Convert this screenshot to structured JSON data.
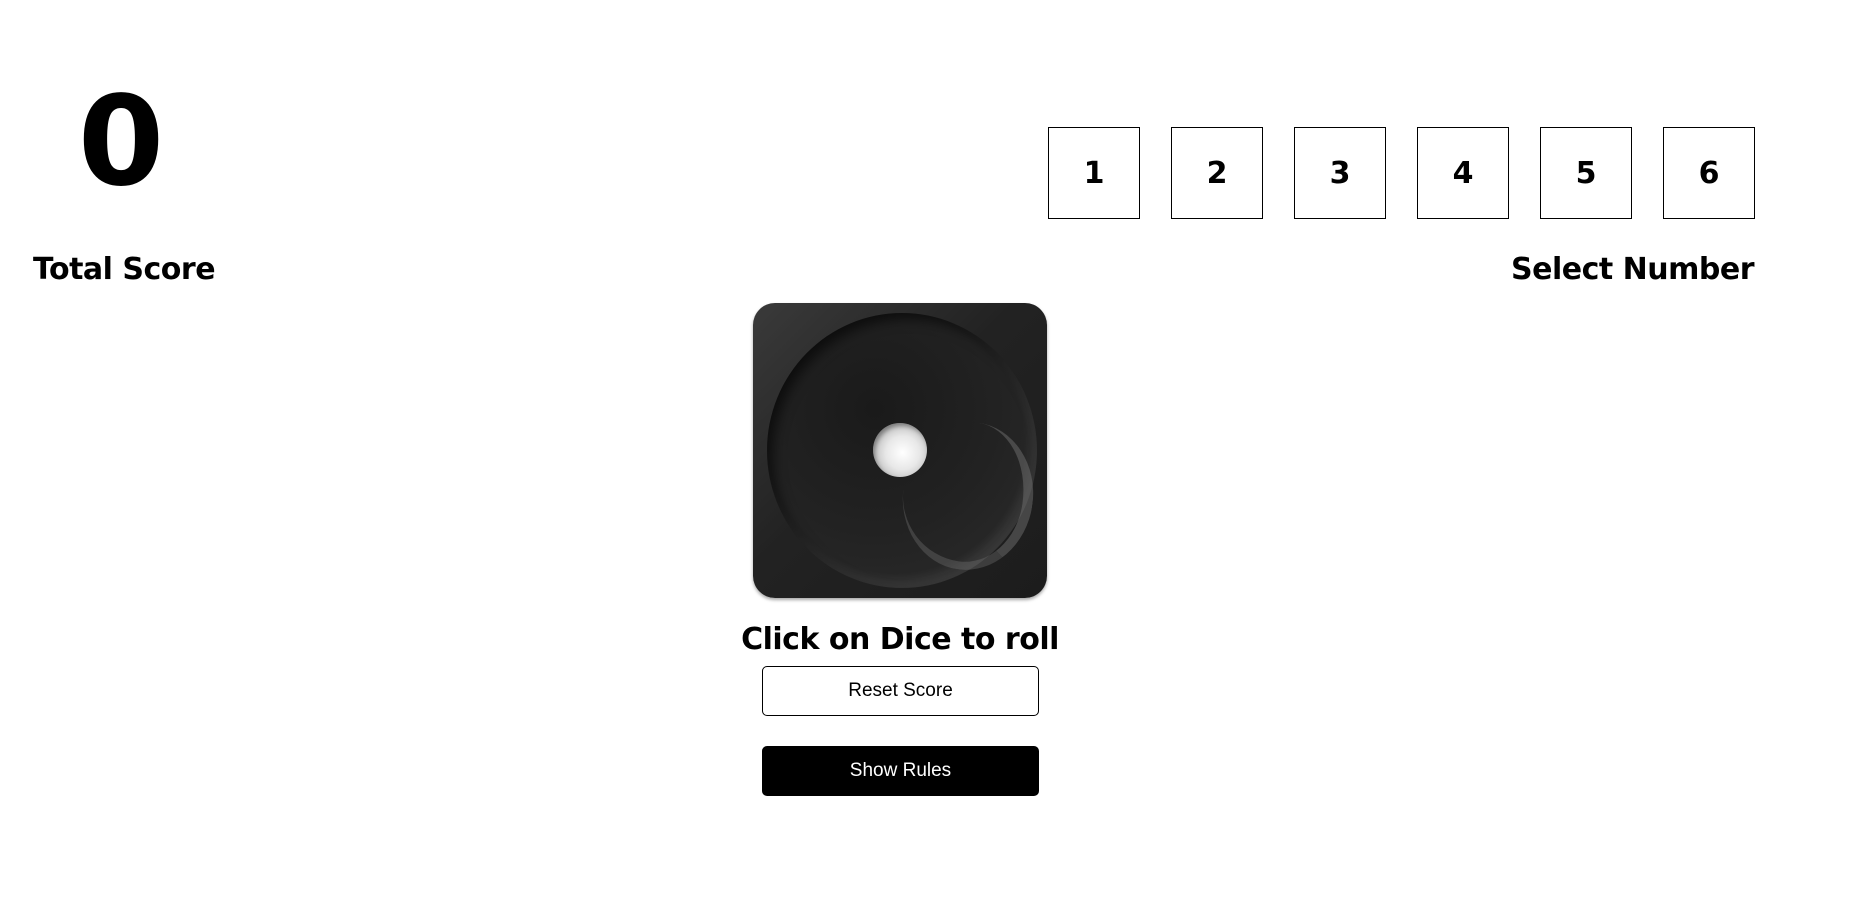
{
  "score": {
    "value": "0",
    "label": "Total Score"
  },
  "number_selector": {
    "label": "Select Number",
    "options": [
      "1",
      "2",
      "3",
      "4",
      "5",
      "6"
    ],
    "selected": null
  },
  "dice": {
    "face_value": 1,
    "icon": "dice-one-icon",
    "instruction": "Click on Dice to roll"
  },
  "buttons": {
    "reset_label": "Reset Score",
    "rules_label": "Show Rules"
  },
  "colors": {
    "background": "#ffffff",
    "text": "#000000",
    "dice": "#222222",
    "rules_button_bg": "#000000",
    "rules_button_text": "#ffffff"
  }
}
